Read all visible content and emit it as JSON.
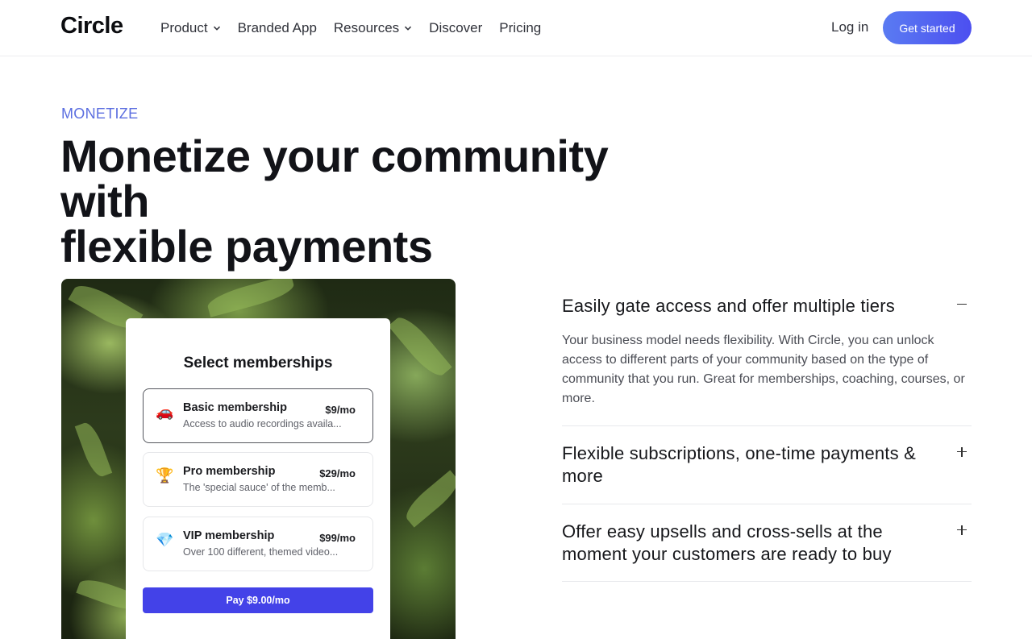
{
  "header": {
    "logo": "Circle",
    "nav": [
      {
        "label": "Product",
        "has_dropdown": true
      },
      {
        "label": "Branded App",
        "has_dropdown": false
      },
      {
        "label": "Resources",
        "has_dropdown": true
      },
      {
        "label": "Discover",
        "has_dropdown": false
      },
      {
        "label": "Pricing",
        "has_dropdown": false
      }
    ],
    "login_label": "Log in",
    "cta_label": "Get started"
  },
  "hero": {
    "eyebrow": "MONETIZE",
    "headline_line1": "Monetize your community with",
    "headline_line2": "flexible payments"
  },
  "membership_card": {
    "title": "Select memberships",
    "tiers": [
      {
        "emoji": "🚗",
        "name": "Basic membership",
        "price": "$9/mo",
        "description": "Access to audio recordings availa...",
        "selected": true
      },
      {
        "emoji": "🏆",
        "name": "Pro membership",
        "price": "$29/mo",
        "description": "The 'special sauce' of the memb...",
        "selected": false
      },
      {
        "emoji": "💎",
        "name": "VIP membership",
        "price": "$99/mo",
        "description": "Over 100 different, themed video...",
        "selected": false
      }
    ],
    "pay_label": "Pay $9.00/mo"
  },
  "accordion": [
    {
      "title": "Easily gate access and offer multiple tiers",
      "expanded": true,
      "body": "Your business model needs flexibility. With Circle, you can unlock access to different parts of your community based on the type of community that you run. Great for memberships, coaching, courses, or more."
    },
    {
      "title": "Flexible subscriptions, one-time payments & more",
      "expanded": false
    },
    {
      "title": "Offer easy upsells and cross-sells at the moment your customers are ready to buy",
      "expanded": false
    }
  ],
  "colors": {
    "accent": "#4c4ff0",
    "eyebrow": "#5b6ee0",
    "pay_button": "#4342e8"
  }
}
